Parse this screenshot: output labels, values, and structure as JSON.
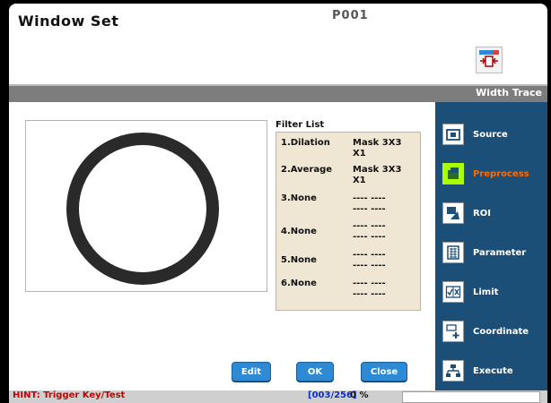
{
  "window": {
    "title": "Window Set",
    "code": "P001"
  },
  "band": {
    "label": "Width Trace"
  },
  "filter_list": {
    "title": "Filter List",
    "rows": [
      {
        "name": "1.Dilation",
        "value": "Mask  3X3",
        "value2": "X1"
      },
      {
        "name": "2.Average",
        "value": "Mask  3X3",
        "value2": "X1"
      },
      {
        "name": "3.None",
        "value": "----  ----",
        "value2": "----  ----"
      },
      {
        "name": "4.None",
        "value": "----  ----",
        "value2": "----  ----"
      },
      {
        "name": "5.None",
        "value": "----  ----",
        "value2": "----  ----"
      },
      {
        "name": "6.None",
        "value": "----  ----",
        "value2": "----  ----"
      }
    ]
  },
  "buttons": {
    "edit": "Edit",
    "ok": "OK",
    "close": "Close"
  },
  "sidebar": {
    "items": [
      {
        "label": "Source",
        "icon": "camera-icon",
        "active": false
      },
      {
        "label": "Preprocess",
        "icon": "filter-icon",
        "active": true
      },
      {
        "label": "ROI",
        "icon": "roi-icon",
        "active": false
      },
      {
        "label": "Parameter",
        "icon": "grid-icon",
        "active": false
      },
      {
        "label": "Limit",
        "icon": "check-x-icon",
        "active": false
      },
      {
        "label": "Coordinate",
        "icon": "coordinate-icon",
        "active": false
      },
      {
        "label": "Execute",
        "icon": "execute-icon",
        "active": false
      }
    ]
  },
  "status": {
    "hint": "HINT: Trigger Key/Test",
    "counter": "[003/256]",
    "percent": "0 %"
  },
  "colors": {
    "sidebar_bg": "#1c4f78",
    "active_label": "#ff6a00",
    "button_blue": "#2f8ad5",
    "band_gray": "#7d7d7d"
  }
}
